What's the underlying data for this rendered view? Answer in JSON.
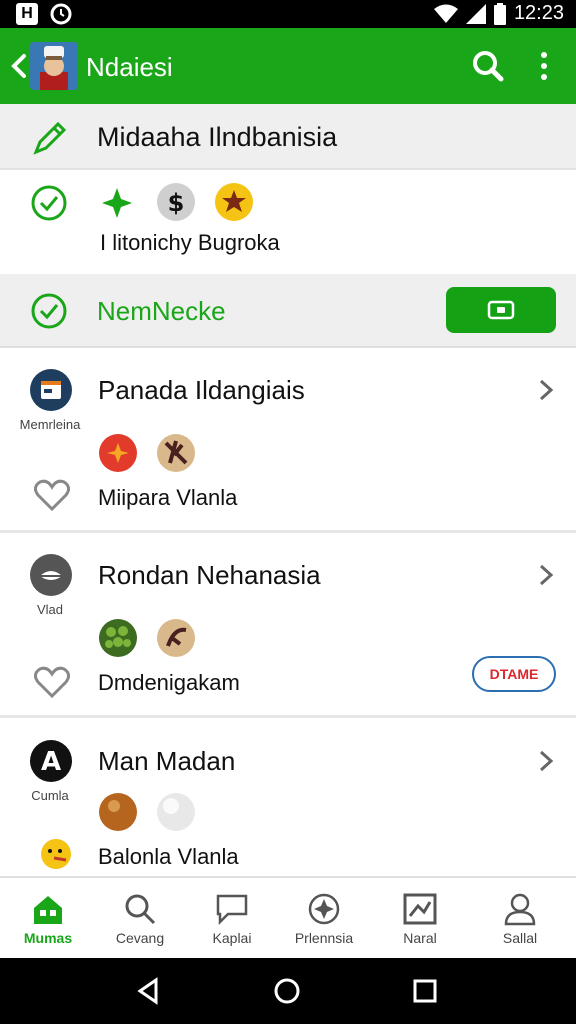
{
  "status_bar": {
    "time": "12:23",
    "left_icons": [
      "notification-h-icon",
      "sync-icon"
    ],
    "right_icons": [
      "wifi-icon",
      "signal-icon",
      "battery-icon"
    ]
  },
  "app_bar": {
    "title": "Ndaiesi",
    "color": "#1aa619"
  },
  "header_row": {
    "title": "Midaaha Ilndbanisia"
  },
  "icons_row": {
    "subtitle": "I litonichy Bugroka"
  },
  "action_row": {
    "label": "NemNecke"
  },
  "cards": [
    {
      "name": "Panada Ildangiais",
      "caption": "Memrleina",
      "sub": "Miipara Vlanla"
    },
    {
      "name": "Rondan Nehanasia",
      "caption": "Vlad",
      "sub": "Dmdenigakam",
      "badge": "DTAME"
    },
    {
      "name": "Man Madan",
      "caption": "Cumla",
      "sub": "Balonla Vlanla"
    }
  ],
  "bottom_nav": [
    {
      "label": "Mumas",
      "icon": "home-icon",
      "active": true
    },
    {
      "label": "Cevang",
      "icon": "search-icon"
    },
    {
      "label": "Kaplai",
      "icon": "chat-icon"
    },
    {
      "label": "Prlennsia",
      "icon": "compass-icon"
    },
    {
      "label": "Naral",
      "icon": "frame-icon"
    },
    {
      "label": "Sallal",
      "icon": "profile-icon"
    }
  ]
}
